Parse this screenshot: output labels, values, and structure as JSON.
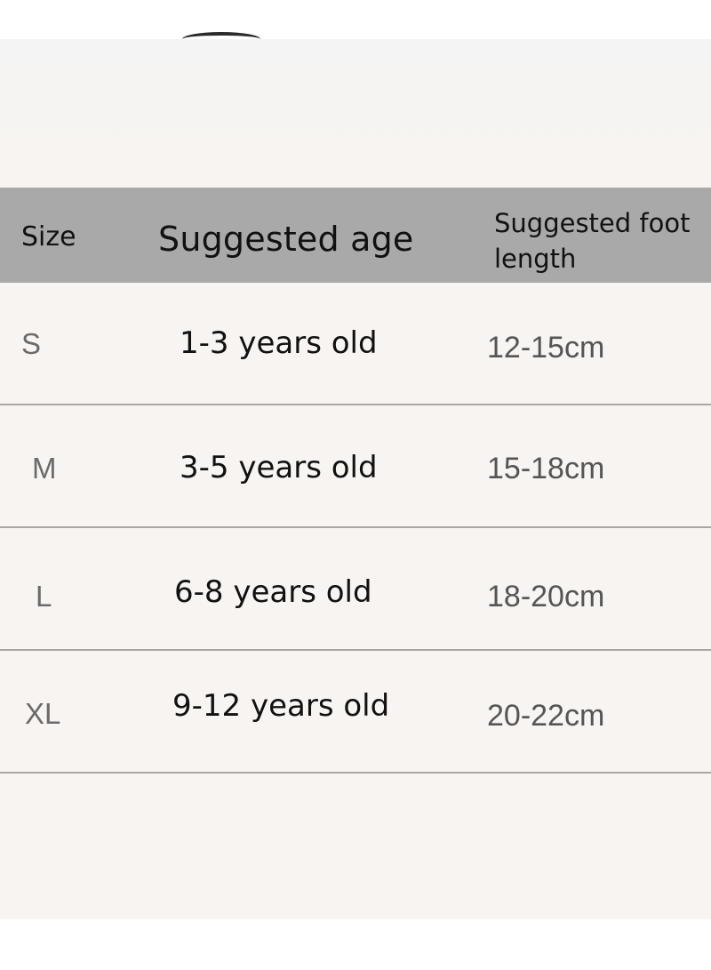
{
  "table": {
    "headers": {
      "size": "Size",
      "age": "Suggested age",
      "foot_length": "Suggested foot length"
    },
    "rows": [
      {
        "size": "S",
        "age": "1-3 years old",
        "foot_length": "12-15cm"
      },
      {
        "size": "M",
        "age": "3-5 years old",
        "foot_length": "15-18cm"
      },
      {
        "size": "L",
        "age": "6-8 years old",
        "foot_length": "18-20cm"
      },
      {
        "size": "XL",
        "age": "9-12 years old",
        "foot_length": "20-22cm"
      }
    ]
  },
  "colors": {
    "header_background": "#a9a9a9",
    "page_background": "#f7f4f1",
    "divider": "#a8a6a5"
  }
}
